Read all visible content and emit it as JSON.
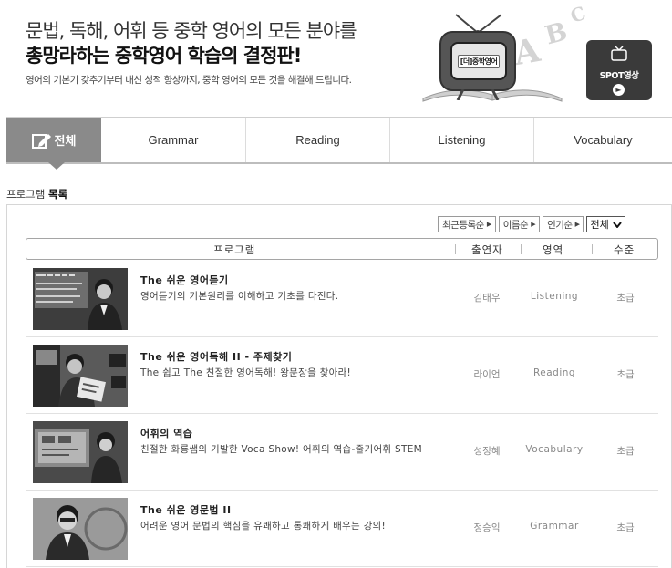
{
  "banner": {
    "headline_1": "문법, 독해, 어휘 등 중학 영어의 모든 분야를",
    "headline_2": "총망라하는 중학영어 학습의 결정판!",
    "subtext": "영어의 기본기 갖추기부터 내신 성적 향상까지, 중학 영어의 모든 것을 해결해 드립니다.",
    "tv_logo": "[더]중학영어",
    "deco_letters": [
      "C",
      "B",
      "A"
    ],
    "spot_label": "SPOT영상",
    "spot_icon": "tv-icon",
    "spot_arrow": "arrow-right-circle-icon"
  },
  "tabs": [
    {
      "label": "전체",
      "active": true,
      "icon": "pencil-icon"
    },
    {
      "label": "Grammar",
      "active": false
    },
    {
      "label": "Reading",
      "active": false
    },
    {
      "label": "Listening",
      "active": false
    },
    {
      "label": "Vocabulary",
      "active": false
    }
  ],
  "section": {
    "title_prefix": "프로그램",
    "title_bold": "목록"
  },
  "sort": {
    "buttons": [
      "최근등록순",
      "이름순",
      "인기순"
    ],
    "arrow_glyph": "▶",
    "select_value": "전체"
  },
  "table": {
    "headers": {
      "program": "프로그램",
      "cast": "출연자",
      "area": "영역",
      "level": "수준"
    },
    "rows": [
      {
        "title": "The 쉬운 영어듣기",
        "desc": "영어듣기의 기본원리를 이해하고 기초를 다진다.",
        "cast": "김태우",
        "area": "Listening",
        "level": "초급"
      },
      {
        "title": "The 쉬운 영어독해 II - 주제찾기",
        "desc": "The 쉽고 The 친절한 영어독해! 왕문장을 찾아라!",
        "cast": "라이언",
        "area": "Reading",
        "level": "초급"
      },
      {
        "title": "어휘의 역습",
        "desc": "친절한 화룡쌤의 기발한 Voca Show! 어휘의 역습-줄기어휘 STEM",
        "cast": "성정혜",
        "area": "Vocabulary",
        "level": "초급"
      },
      {
        "title": "The 쉬운 영문법 II",
        "desc": "어려운 영어 문법의 핵심을 유쾌하고 통쾌하게 배우는 강의!",
        "cast": "정승익",
        "area": "Grammar",
        "level": "초급"
      }
    ]
  },
  "colors": {
    "active_tab": "#8a8a8a",
    "spot_bg": "#3a3a3a",
    "muted_text": "#888888"
  }
}
